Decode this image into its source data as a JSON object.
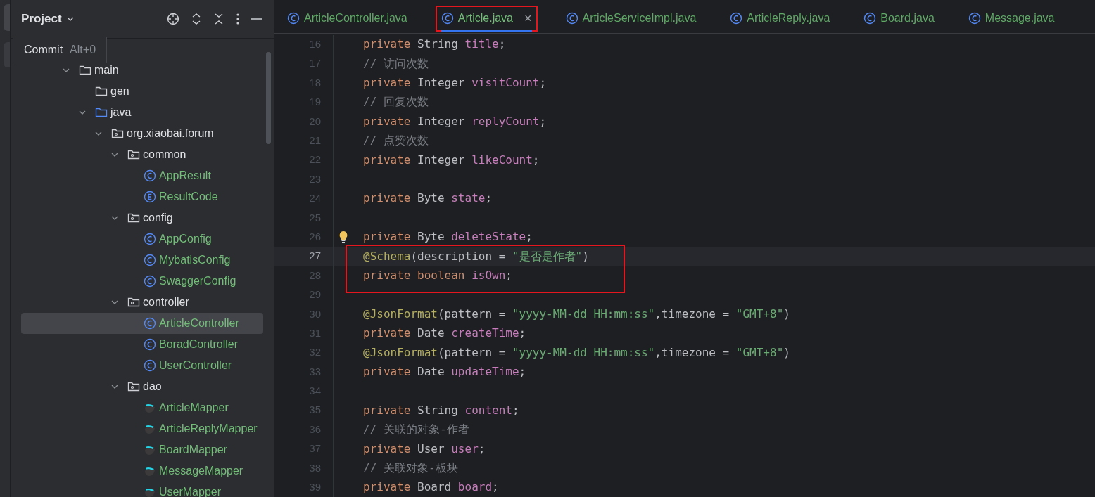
{
  "project_panel": {
    "title": "Project",
    "tooltip": {
      "label": "Commit",
      "shortcut": "Alt+0"
    },
    "tree": [
      {
        "label": "main",
        "kind": "folder",
        "expanded": true,
        "selected": false,
        "children": [
          {
            "label": "gen",
            "kind": "folder",
            "selected": false
          },
          {
            "label": "java",
            "kind": "source-folder",
            "expanded": true,
            "selected": false,
            "children": [
              {
                "label": "org.xiaobai.forum",
                "kind": "package",
                "expanded": true,
                "selected": false,
                "children": [
                  {
                    "label": "common",
                    "kind": "package",
                    "expanded": true,
                    "selected": false,
                    "children": [
                      {
                        "label": "AppResult",
                        "kind": "class",
                        "selected": false
                      },
                      {
                        "label": "ResultCode",
                        "kind": "enum",
                        "selected": false
                      }
                    ]
                  },
                  {
                    "label": "config",
                    "kind": "package",
                    "expanded": true,
                    "selected": false,
                    "children": [
                      {
                        "label": "AppConfig",
                        "kind": "class",
                        "selected": false
                      },
                      {
                        "label": "MybatisConfig",
                        "kind": "class",
                        "selected": false
                      },
                      {
                        "label": "SwaggerConfig",
                        "kind": "class",
                        "selected": false
                      }
                    ]
                  },
                  {
                    "label": "controller",
                    "kind": "package",
                    "expanded": true,
                    "selected": false,
                    "children": [
                      {
                        "label": "ArticleController",
                        "kind": "class",
                        "selected": true
                      },
                      {
                        "label": "BoradController",
                        "kind": "class",
                        "selected": false
                      },
                      {
                        "label": "UserController",
                        "kind": "class",
                        "selected": false
                      }
                    ]
                  },
                  {
                    "label": "dao",
                    "kind": "package",
                    "expanded": true,
                    "selected": false,
                    "children": [
                      {
                        "label": "ArticleMapper",
                        "kind": "mapper",
                        "selected": false
                      },
                      {
                        "label": "ArticleReplyMapper",
                        "kind": "mapper",
                        "selected": false
                      },
                      {
                        "label": "BoardMapper",
                        "kind": "mapper",
                        "selected": false
                      },
                      {
                        "label": "MessageMapper",
                        "kind": "mapper",
                        "selected": false
                      },
                      {
                        "label": "UserMapper",
                        "kind": "mapper",
                        "selected": false
                      }
                    ]
                  }
                ]
              }
            ]
          }
        ]
      }
    ]
  },
  "tabs": [
    {
      "label": "ArticleController.java",
      "selected": false,
      "outlined": false
    },
    {
      "label": "Article.java",
      "selected": true,
      "outlined": true,
      "close": "×"
    },
    {
      "label": "ArticleServiceImpl.java",
      "selected": false,
      "outlined": false
    },
    {
      "label": "ArticleReply.java",
      "selected": false,
      "outlined": false
    },
    {
      "label": "Board.java",
      "selected": false,
      "outlined": false
    },
    {
      "label": "Message.java",
      "selected": false,
      "outlined": false
    }
  ],
  "editor": {
    "lines": [
      {
        "number": "16",
        "current": false,
        "outlined": false,
        "tokens": [
          {
            "kind": "kw",
            "text": "private "
          },
          {
            "kind": "plain",
            "text": "String "
          },
          {
            "kind": "field",
            "text": "title"
          },
          {
            "kind": "plain",
            "text": ";"
          }
        ]
      },
      {
        "number": "17",
        "current": false,
        "outlined": false,
        "tokens": [
          {
            "kind": "comment",
            "text": "// 访问次数"
          }
        ]
      },
      {
        "number": "18",
        "current": false,
        "outlined": false,
        "tokens": [
          {
            "kind": "kw",
            "text": "private "
          },
          {
            "kind": "plain",
            "text": "Integer "
          },
          {
            "kind": "field",
            "text": "visitCount"
          },
          {
            "kind": "plain",
            "text": ";"
          }
        ]
      },
      {
        "number": "19",
        "current": false,
        "outlined": false,
        "tokens": [
          {
            "kind": "comment",
            "text": "// 回复次数"
          }
        ]
      },
      {
        "number": "20",
        "current": false,
        "outlined": false,
        "tokens": [
          {
            "kind": "kw",
            "text": "private "
          },
          {
            "kind": "plain",
            "text": "Integer "
          },
          {
            "kind": "field",
            "text": "replyCount"
          },
          {
            "kind": "plain",
            "text": ";"
          }
        ]
      },
      {
        "number": "21",
        "current": false,
        "outlined": false,
        "tokens": [
          {
            "kind": "comment",
            "text": "// 点赞次数"
          }
        ]
      },
      {
        "number": "22",
        "current": false,
        "outlined": false,
        "tokens": [
          {
            "kind": "kw",
            "text": "private "
          },
          {
            "kind": "plain",
            "text": "Integer "
          },
          {
            "kind": "field",
            "text": "likeCount"
          },
          {
            "kind": "plain",
            "text": ";"
          }
        ]
      },
      {
        "number": "23",
        "current": false
      },
      {
        "number": "24",
        "current": false,
        "outlined": false,
        "tokens": [
          {
            "kind": "kw",
            "text": "private "
          },
          {
            "kind": "plain",
            "text": "Byte "
          },
          {
            "kind": "field",
            "text": "state"
          },
          {
            "kind": "plain",
            "text": ";"
          }
        ]
      },
      {
        "number": "25",
        "current": false
      },
      {
        "number": "26",
        "current": false,
        "bulb": true,
        "tokens": [
          {
            "kind": "kw",
            "text": "private "
          },
          {
            "kind": "plain",
            "text": "Byte "
          },
          {
            "kind": "field",
            "text": "deleteState"
          },
          {
            "kind": "plain",
            "text": ";"
          }
        ]
      },
      {
        "number": "27",
        "current": true,
        "outlined": true,
        "tokens": [
          {
            "kind": "ann",
            "text": "@Schema"
          },
          {
            "kind": "plain",
            "text": "(description = "
          },
          {
            "kind": "str",
            "text": "\"是否是作者\""
          },
          {
            "kind": "plain",
            "text": ")"
          }
        ]
      },
      {
        "number": "28",
        "current": false,
        "outlined": true,
        "tokens": [
          {
            "kind": "kw",
            "text": "private "
          },
          {
            "kind": "kw",
            "text": "boolean "
          },
          {
            "kind": "field",
            "text": "isOwn"
          },
          {
            "kind": "plain",
            "text": ";"
          }
        ]
      },
      {
        "number": "29",
        "current": false
      },
      {
        "number": "30",
        "current": false,
        "outlined": false,
        "tokens": [
          {
            "kind": "ann",
            "text": "@JsonFormat"
          },
          {
            "kind": "plain",
            "text": "(pattern = "
          },
          {
            "kind": "str",
            "text": "\"yyyy-MM-dd HH:mm:ss\""
          },
          {
            "kind": "plain",
            "text": ",timezone = "
          },
          {
            "kind": "str",
            "text": "\"GMT+8\""
          },
          {
            "kind": "plain",
            "text": ")"
          }
        ]
      },
      {
        "number": "31",
        "current": false,
        "outlined": false,
        "tokens": [
          {
            "kind": "kw",
            "text": "private "
          },
          {
            "kind": "plain",
            "text": "Date "
          },
          {
            "kind": "field",
            "text": "createTime"
          },
          {
            "kind": "plain",
            "text": ";"
          }
        ]
      },
      {
        "number": "32",
        "current": false,
        "outlined": false,
        "tokens": [
          {
            "kind": "ann",
            "text": "@JsonFormat"
          },
          {
            "kind": "plain",
            "text": "(pattern = "
          },
          {
            "kind": "str",
            "text": "\"yyyy-MM-dd HH:mm:ss\""
          },
          {
            "kind": "plain",
            "text": ",timezone = "
          },
          {
            "kind": "str",
            "text": "\"GMT+8\""
          },
          {
            "kind": "plain",
            "text": ")"
          }
        ]
      },
      {
        "number": "33",
        "current": false,
        "outlined": false,
        "tokens": [
          {
            "kind": "kw",
            "text": "private "
          },
          {
            "kind": "plain",
            "text": "Date "
          },
          {
            "kind": "field",
            "text": "updateTime"
          },
          {
            "kind": "plain",
            "text": ";"
          }
        ]
      },
      {
        "number": "34",
        "current": false
      },
      {
        "number": "35",
        "current": false,
        "outlined": false,
        "tokens": [
          {
            "kind": "kw",
            "text": "private "
          },
          {
            "kind": "plain",
            "text": "String "
          },
          {
            "kind": "field",
            "text": "content"
          },
          {
            "kind": "plain",
            "text": ";"
          }
        ]
      },
      {
        "number": "36",
        "current": false,
        "outlined": false,
        "tokens": [
          {
            "kind": "comment",
            "text": "// 关联的对象-作者"
          }
        ]
      },
      {
        "number": "37",
        "current": false,
        "outlined": false,
        "tokens": [
          {
            "kind": "kw",
            "text": "private "
          },
          {
            "kind": "plain",
            "text": "User "
          },
          {
            "kind": "field",
            "text": "user"
          },
          {
            "kind": "plain",
            "text": ";"
          }
        ]
      },
      {
        "number": "38",
        "current": false,
        "outlined": false,
        "tokens": [
          {
            "kind": "comment",
            "text": "// 关联对象-板块"
          }
        ]
      },
      {
        "number": "39",
        "current": false,
        "outlined": false,
        "tokens": [
          {
            "kind": "kw",
            "text": "private "
          },
          {
            "kind": "plain",
            "text": "Board "
          },
          {
            "kind": "field",
            "text": "board"
          },
          {
            "kind": "plain",
            "text": ";"
          }
        ]
      }
    ]
  }
}
